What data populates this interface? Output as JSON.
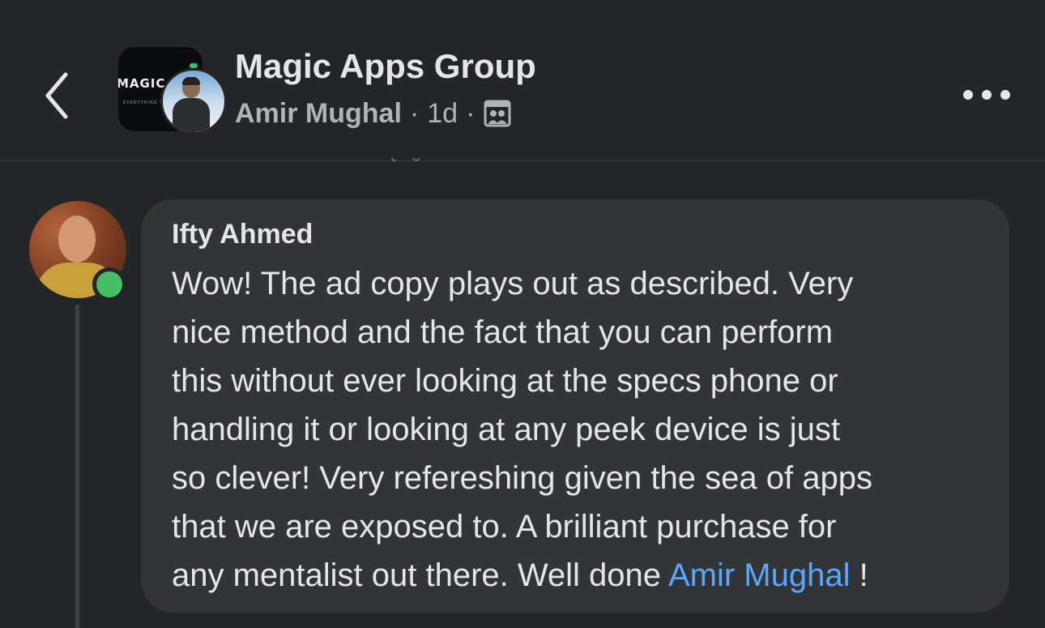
{
  "header": {
    "group_name": "Magic Apps Group",
    "author": "Amir Mughal",
    "separator": "·",
    "time_ago": "1d",
    "audience_icon": "group-members-icon",
    "group_logo_text": "MAGIC",
    "group_logo_subtext": "EVERYTHING YOU"
  },
  "comment": {
    "author": "Ifty Ahmed",
    "online": true,
    "lines": [
      "Wow! The ad copy plays out as described. Very",
      "nice method and the fact that you can perform",
      "this without ever looking at the specs phone or",
      "handling it or looking at any peek device is just",
      "so clever! Very refereshing given the sea of apps",
      "that we are exposed to. A brilliant purchase for",
      "any mentalist out there. Well done "
    ],
    "mention": "Amir Mughal",
    "after_mention": " !"
  },
  "colors": {
    "background": "#242526",
    "bubble": "#333436",
    "primary_text": "#e4e6eb",
    "secondary_text": "#b0b3b8",
    "mention": "#5aa7ff",
    "online": "#45bd62"
  }
}
